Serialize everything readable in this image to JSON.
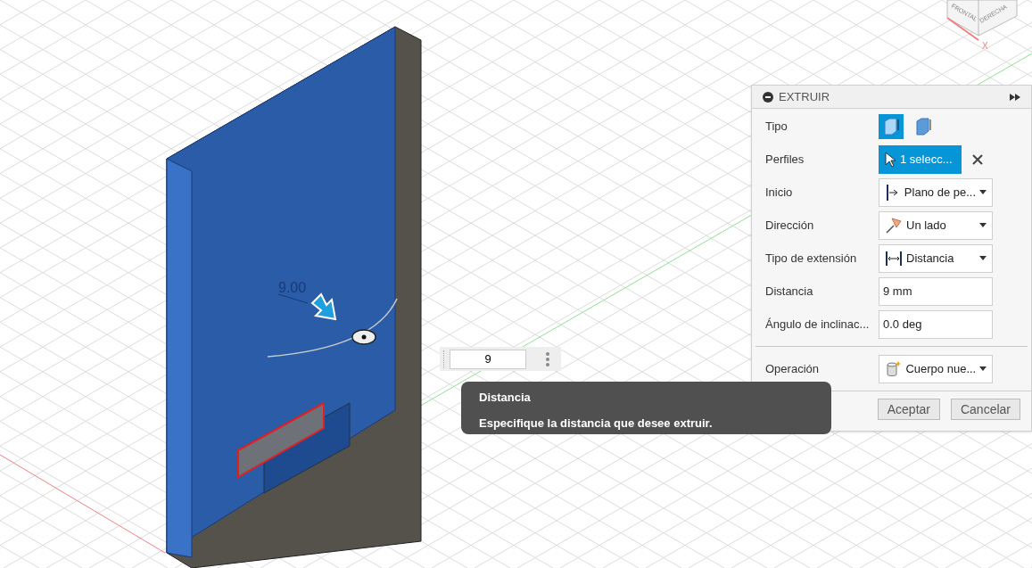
{
  "viewport": {
    "dimension_label": "9.00",
    "view_cube": {
      "faces": [
        "FRONTAL",
        "DERECHA"
      ],
      "axis": "X"
    }
  },
  "distance_input": {
    "value": "9"
  },
  "tooltip": {
    "title": "Distancia",
    "text": "Especifique la distancia que desee extruir."
  },
  "panel": {
    "title": "EXTRUIR",
    "rows": [
      {
        "kind": "type",
        "label": "Tipo",
        "options": [
          {
            "selected": true
          },
          {
            "selected": false
          }
        ]
      },
      {
        "kind": "selection",
        "label": "Perfiles",
        "value": "1 selecc..."
      },
      {
        "kind": "dropdown",
        "label": "Inicio",
        "value": "Plano de pe..."
      },
      {
        "kind": "dropdown",
        "label": "Dirección",
        "value": "Un lado"
      },
      {
        "kind": "dropdown",
        "label": "Tipo de extensión",
        "value": "Distancia"
      },
      {
        "kind": "input",
        "label": "Distancia",
        "value": "9 mm"
      },
      {
        "kind": "input",
        "label": "Ángulo de inclinac...",
        "value": "0.0 deg"
      },
      {
        "kind": "divider"
      },
      {
        "kind": "dropdown",
        "label": "Operación",
        "value": "Cuerpo nue..."
      }
    ],
    "buttons": [
      "Aceptar",
      "Cancelar"
    ]
  }
}
